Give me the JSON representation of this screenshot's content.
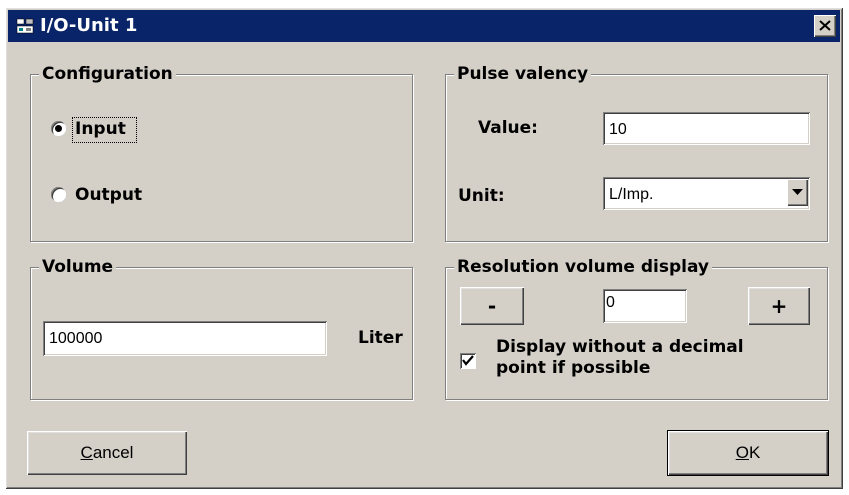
{
  "window": {
    "title": "I/O-Unit 1"
  },
  "configuration": {
    "legend": "Configuration",
    "options": [
      {
        "label": "Input",
        "selected": true
      },
      {
        "label": "Output",
        "selected": false
      }
    ]
  },
  "pulse_valency": {
    "legend": "Pulse valency",
    "value_label": "Value:",
    "value": "10",
    "unit_label": "Unit:",
    "unit_selected": "L/Imp."
  },
  "volume": {
    "legend": "Volume",
    "value": "100000",
    "unit": "Liter"
  },
  "resolution": {
    "legend": "Resolution volume display",
    "minus_label": "-",
    "value": "0",
    "plus_label": "+",
    "checkbox_label_line1": "Display without a decimal",
    "checkbox_label_line2": "point if possible",
    "checkbox_checked": true
  },
  "buttons": {
    "cancel_accel": "C",
    "cancel_rest": "ancel",
    "ok_accel": "O",
    "ok_rest": "K"
  },
  "icons": {
    "app": "io-unit-icon",
    "close": "close-icon",
    "dropdown": "chevron-down-icon",
    "check": "check-icon"
  },
  "colors": {
    "titlebar": "#0a246a",
    "face": "#d4d0c8"
  }
}
